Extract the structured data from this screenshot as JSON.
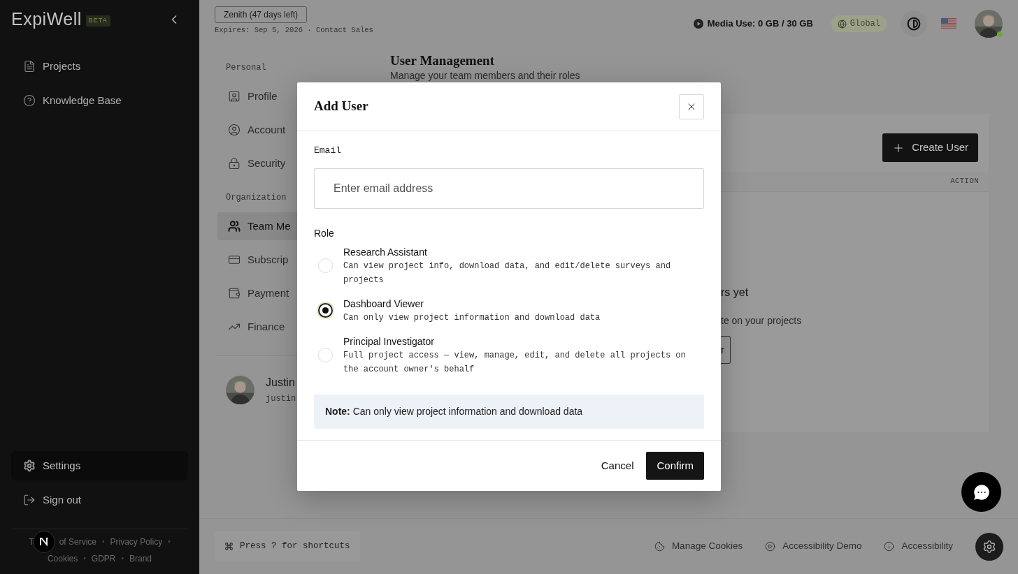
{
  "sidebar": {
    "logo": "ExpiWell",
    "badge": "BETA",
    "nav": [
      {
        "label": "Projects",
        "selected": false
      },
      {
        "label": "Knowledge Base",
        "selected": false
      }
    ],
    "bottom_nav": [
      {
        "label": "Settings",
        "selected": true
      },
      {
        "label": "Sign out",
        "selected": false
      }
    ],
    "footer_link_fragment": "T",
    "footer_separator": "•",
    "footer_links": [
      "of Service",
      "Privacy Policy",
      "Cookies",
      "GDPR",
      "Brand"
    ]
  },
  "top_bar": {
    "plan": "Zenith (47 days left)",
    "expiry": "Expires: Sep 5, 2026 · Contact Sales",
    "media_use": "Media Use: 0 GB / 30 GB",
    "region": "Global"
  },
  "settings_nav": {
    "groups": [
      {
        "heading": "Personal",
        "items": [
          {
            "label": "Profile",
            "selected": false
          },
          {
            "label": "Account",
            "selected": false
          },
          {
            "label": "Security",
            "selected": false
          }
        ]
      },
      {
        "heading": "Organization",
        "items": [
          {
            "label": "Team Me",
            "selected": true
          },
          {
            "label": "Subscrip",
            "selected": false
          },
          {
            "label": "Payment",
            "selected": false
          },
          {
            "label": "Finance",
            "selected": false
          }
        ]
      }
    ],
    "user": {
      "name": "Justin",
      "email": "justin"
    }
  },
  "content": {
    "title": "User Management",
    "subtitle": "Manage your team members and their roles",
    "create_button": "Create User",
    "columns": [
      "ACTION"
    ],
    "empty_title": "rs yet",
    "empty_text": "te on your projects",
    "empty_button": "r"
  },
  "footer": {
    "shortcut_hint": "Press ? for shortcuts",
    "links": [
      "Manage Cookies",
      "Accessibility Demo",
      "Accessibility"
    ]
  },
  "dialog": {
    "title": "Add User",
    "email_label": "Email",
    "email_placeholder": "Enter email address",
    "role_label": "Role",
    "roles": [
      {
        "title": "Research Assistant",
        "description": "Can view project info, download data, and edit/delete surveys and projects",
        "selected": false
      },
      {
        "title": "Dashboard Viewer",
        "description": "Can only view project information and download data",
        "selected": true
      },
      {
        "title": "Principal Investigator",
        "description": "Full project access — view, manage, edit, and delete all projects on the account owner's behalf",
        "selected": false
      }
    ],
    "note": "**Note:** Can only view project information and download data",
    "cancel": "Cancel",
    "confirm": "Confirm"
  }
}
